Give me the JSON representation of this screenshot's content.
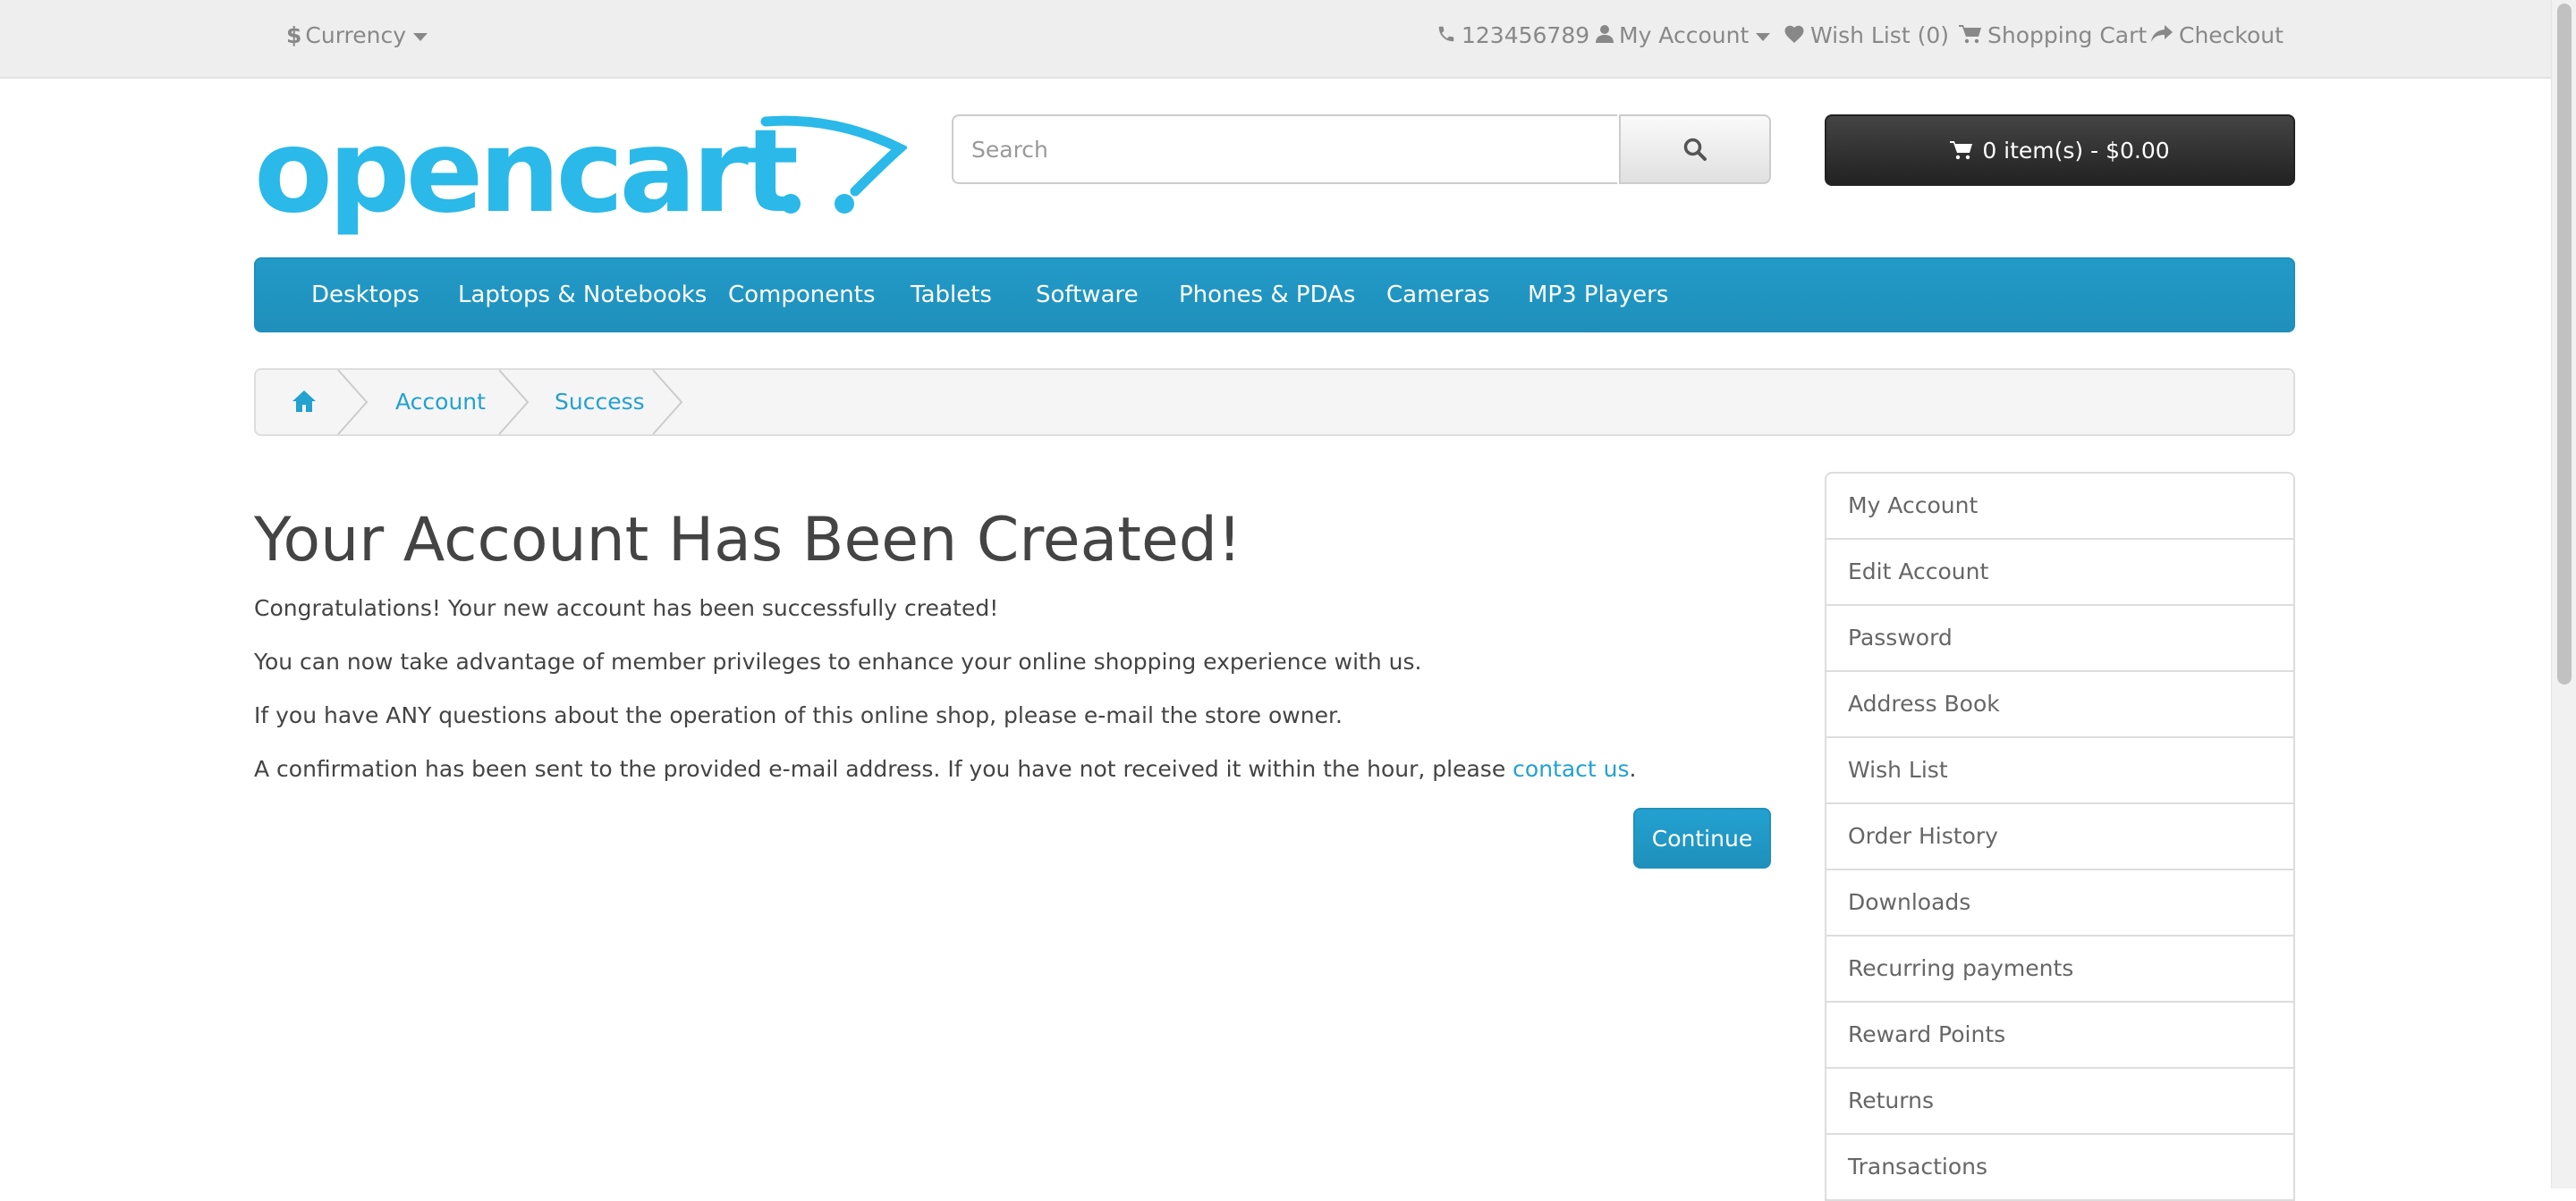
{
  "top_bar": {
    "currency": "Currency",
    "phone": "123456789",
    "my_account": "My Account",
    "wish_list": "Wish List (0)",
    "shopping_cart": "Shopping Cart",
    "checkout": "Checkout"
  },
  "header": {
    "logo_text": "opencart",
    "search_placeholder": "Search",
    "cart_label": "0 item(s) - $0.00"
  },
  "menu": {
    "items": [
      "Desktops",
      "Laptops & Notebooks",
      "Components",
      "Tablets",
      "Software",
      "Phones & PDAs",
      "Cameras",
      "MP3 Players"
    ]
  },
  "breadcrumb": {
    "items": [
      "Account",
      "Success"
    ]
  },
  "content": {
    "heading": "Your Account Has Been Created!",
    "paragraphs": [
      "Congratulations! Your new account has been successfully created!",
      "You can now take advantage of member privileges to enhance your online shopping experience with us.",
      "If you have ANY questions about the operation of this online shop, please e-mail the store owner."
    ],
    "confirmation_prefix": "A confirmation has been sent to the provided e-mail address. If you have not received it within the hour, please ",
    "contact_link": "contact us",
    "confirmation_suffix": ".",
    "continue_label": "Continue"
  },
  "sidebar": {
    "items": [
      "My Account",
      "Edit Account",
      "Password",
      "Address Book",
      "Wish List",
      "Order History",
      "Downloads",
      "Recurring payments",
      "Reward Points",
      "Returns",
      "Transactions"
    ]
  },
  "colors": {
    "accent": "#229ac8",
    "link": "#23a1d1",
    "cart_bg": "#363636",
    "top_bar_bg": "#eeeeee"
  }
}
